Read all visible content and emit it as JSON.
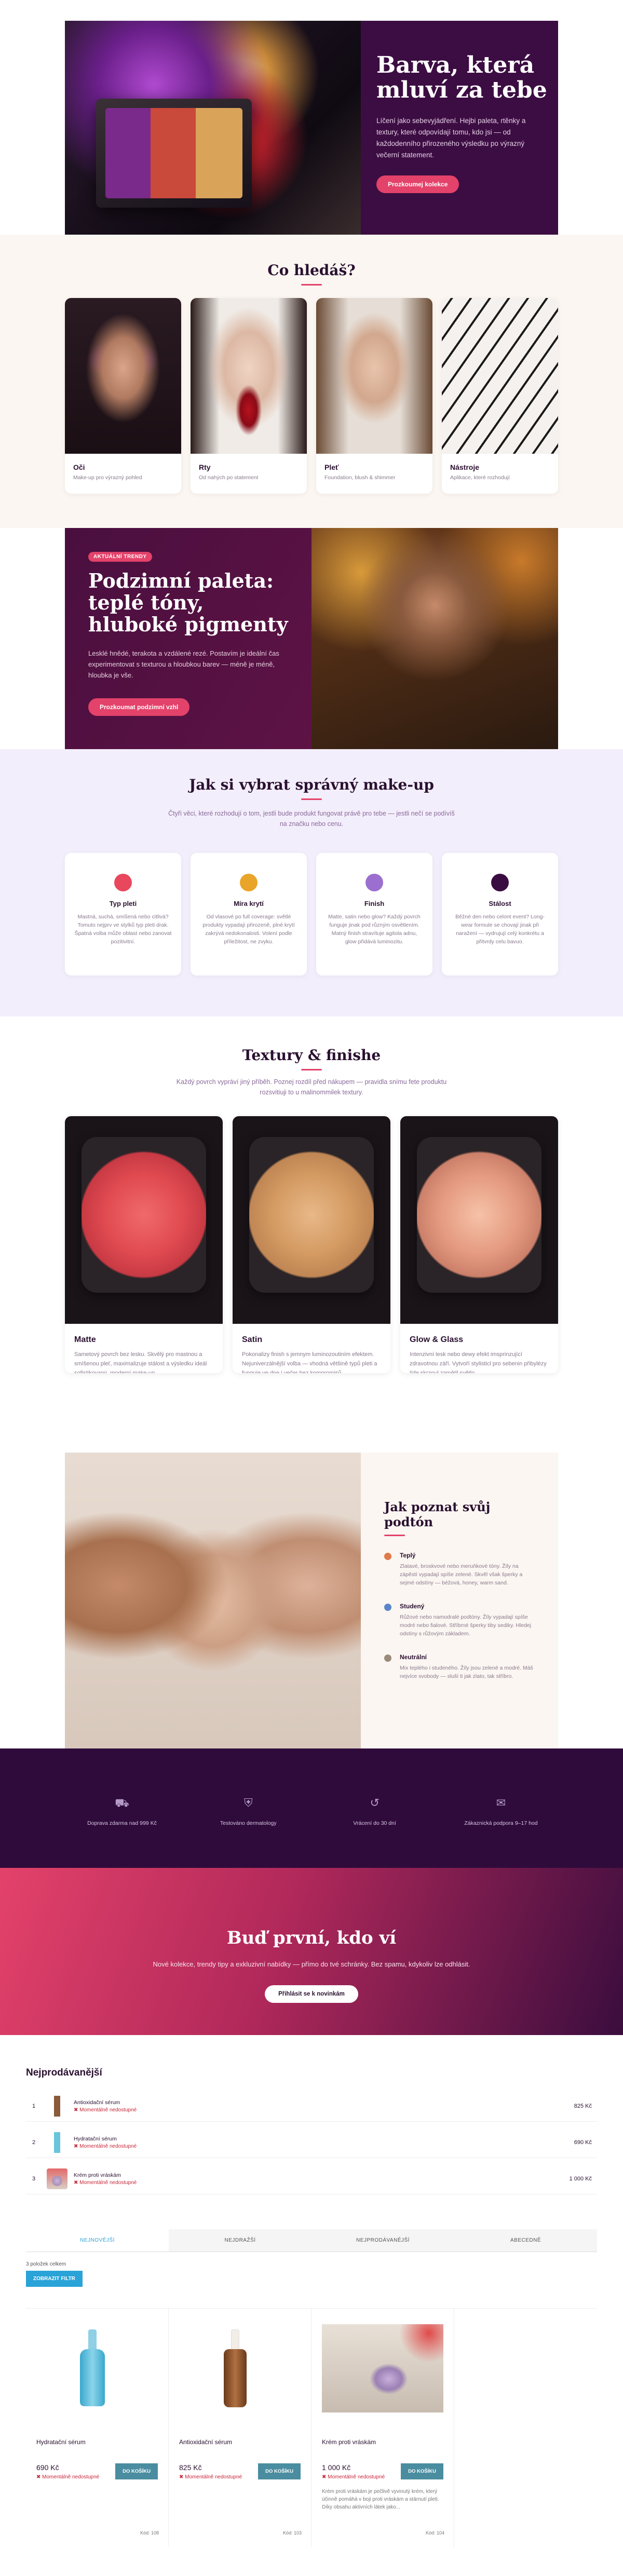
{
  "hero": {
    "title": "Barva, která mluví za tebe",
    "desc": "Líčení jako sebevyjádření. Hejbi paleta, rtěnky a textury, které odpovídají tomu, kdo jsi — od každodenního přirozeného výsledku po výrazný večerní statement.",
    "cta": "Prozkoumej kolekce"
  },
  "categories": {
    "title": "Co hledáš?",
    "items": [
      {
        "name": "Oči",
        "sub": "Make-up pro výrazný pohled"
      },
      {
        "name": "Rty",
        "sub": "Od nahých po statement"
      },
      {
        "name": "Pleť",
        "sub": "Foundation, blush & shimmer"
      },
      {
        "name": "Nástroje",
        "sub": "Aplikace, které rozhodují"
      }
    ]
  },
  "autumn": {
    "badge": "AKTUÁLNÍ TRENDY",
    "title": "Podzimní paleta: teplé tóny, hluboké pigmenty",
    "desc": "Lesklé hnědé, terakota a vzdálené rezé. Postavím je ideální čas experimentovat s texturou a hloubkou barev — méně je méně, hloubka je vše.",
    "cta": "Prozkoumat podzimní vzhl"
  },
  "choose": {
    "title": "Jak si vybrat správný make-up",
    "sub": "Čtyři věci, které rozhodují o tom, jestli bude produkt fungovat právě pro tebe — jestli nečí se podívíš na značku nebo cenu.",
    "items": [
      {
        "name": "Typ pleti",
        "desc": "Mastná, suchá, smíšená nebo citlivá? Tomuto nejprv ve stylků typ pleti drak. Špatná volba může oblast nebo zanovat pozitivitní."
      },
      {
        "name": "Míra krytí",
        "desc": "Od vlasové po full coverage: světlé produkty vypadají přirozeně, plné krytí zakrývá nedokonalosti. Volení podle příležitost, ne zvyku."
      },
      {
        "name": "Finish",
        "desc": "Matte, satin nebo glow? Každý povrch funguje jinak pod různým osvětlením. Matný finish stravítuje agitola adnu, glow přidává luminozitu."
      },
      {
        "name": "Stálost",
        "desc": "Běžné den nebo celont event? Long-wear formule se chovají jinak při naražení — vydrujují celý konkrétu a přitvrdy celu bavuo."
      }
    ],
    "colors": [
      "#e8475e",
      "#e9a52a",
      "#9b6fd0",
      "#3a0d42"
    ]
  },
  "textures": {
    "title": "Textury & finishe",
    "sub": "Každý povrch vypráví jiný příběh. Poznej rozdíl před nákupem — pravidla snímu fete produktu rozsvitiuji to u malinommilek textury.",
    "items": [
      {
        "name": "Matte",
        "desc": "Sametový povrch bez lesku. Skvělý pro mastnou a smíšenou pleť, maximalizuje stálost a výsledku ideál sofistikovaný, moderní make-up."
      },
      {
        "name": "Satin",
        "desc": "Pokonalizy finish s jemnym luminozoutiním efektem. Nejuniverzálnější volba — vhodná většině typů pleti a funguje ve dne i večer bez kompromisů."
      },
      {
        "name": "Glow & Glass",
        "desc": "Intenzivní lesk nebo dewy efekt imsprinzující zdravotnou září. Vytvoří stylisticl pro sebenin přibylézy líde skrzoul zamětil světlo."
      }
    ]
  },
  "undertone": {
    "title": "Jak poznat svůj podtón",
    "items": [
      {
        "name": "Teplý",
        "desc": "Zlatavé, broskvové nebo meruňkové tóny. Žíly na zápěstí vypadají spíše zelené. Skvěl však šperky a sejmé odstíny — béžová, honey, warm sand.",
        "color": "#e07a4a"
      },
      {
        "name": "Studený",
        "desc": "Růžové nebo namodralé podtóny. Žíly vypadají spíše modré nebo fialové. Stříbrné šperky tiby sediky. Hledej odstíny s růžovým základem.",
        "color": "#5a86c8"
      },
      {
        "name": "Neutrální",
        "desc": "Mix teplého i studeného. Žíly jsou zelené a modré. Máš nejvíce svobody — sluší ti jak zlato, tak stříbro.",
        "color": "#9a8a7a"
      }
    ]
  },
  "features": [
    {
      "icon": "truck-icon",
      "label": "Doprava zdarma nad 999 Kč"
    },
    {
      "icon": "shield-icon",
      "label": "Testováno dermatology"
    },
    {
      "icon": "return-icon",
      "label": "Vrácení do 30 dní"
    },
    {
      "icon": "chat-icon",
      "label": "Zákaznická podpora 9–17 hod"
    }
  ],
  "news": {
    "title": "Buď první, kdo ví",
    "desc": "Nové kolekce, trendy tipy a exkluzivní nabídky — přímo do tvé schránky. Bez spamu, kdykoliv lze odhlásit.",
    "cta": "Přihlásit se k novinkám"
  },
  "best": {
    "title": "Nejprodávanější",
    "items": [
      {
        "num": "1",
        "name": "Antioxidační sérum",
        "stock": "Momentálně nedostupné",
        "price": "825 Kč"
      },
      {
        "num": "2",
        "name": "Hydratační sérum",
        "stock": "Momentálně nedostupné",
        "price": "690 Kč"
      },
      {
        "num": "3",
        "name": "Krém proti vráskám",
        "stock": "Momentálně nedostupné",
        "price": "1 000 Kč"
      }
    ]
  },
  "prods": {
    "tabs": [
      "NEJNOVĚJŠÍ",
      "NEJDRAŽŠÍ",
      "NEJPRODÁVANĚJŠÍ",
      "ABECEDNĚ"
    ],
    "count": "3 položek celkem",
    "filter": "ZOBRAZIT FILTR",
    "items": [
      {
        "name": "Hydratační sérum",
        "price": "690 Kč",
        "stock": "Momentálně nedostupné",
        "add": "DO KOŠÍKU",
        "desc": "",
        "code": "Kód: 108"
      },
      {
        "name": "Antioxidační sérum",
        "price": "825 Kč",
        "stock": "Momentálně nedostupné",
        "add": "DO KOŠÍKU",
        "desc": "",
        "code": "Kód: 103"
      },
      {
        "name": "Krém proti vráskám",
        "price": "1 000 Kč",
        "stock": "Momentálně nedostupné",
        "add": "DO KOŠÍKU",
        "desc": "Krém proti vráskám je pečlivě vyvinutý krém, který účinně pomáhá v boji proti vráskám a stárnutí pleti. Díky obsahu aktivních látek jako...",
        "code": "Kód: 104"
      }
    ]
  },
  "colors": {
    "accent": "#e3426a",
    "plum": "#3c0d42",
    "tab_active": "#29a3d8",
    "add_button": "#4a8da0",
    "stock": "#c8283a"
  }
}
